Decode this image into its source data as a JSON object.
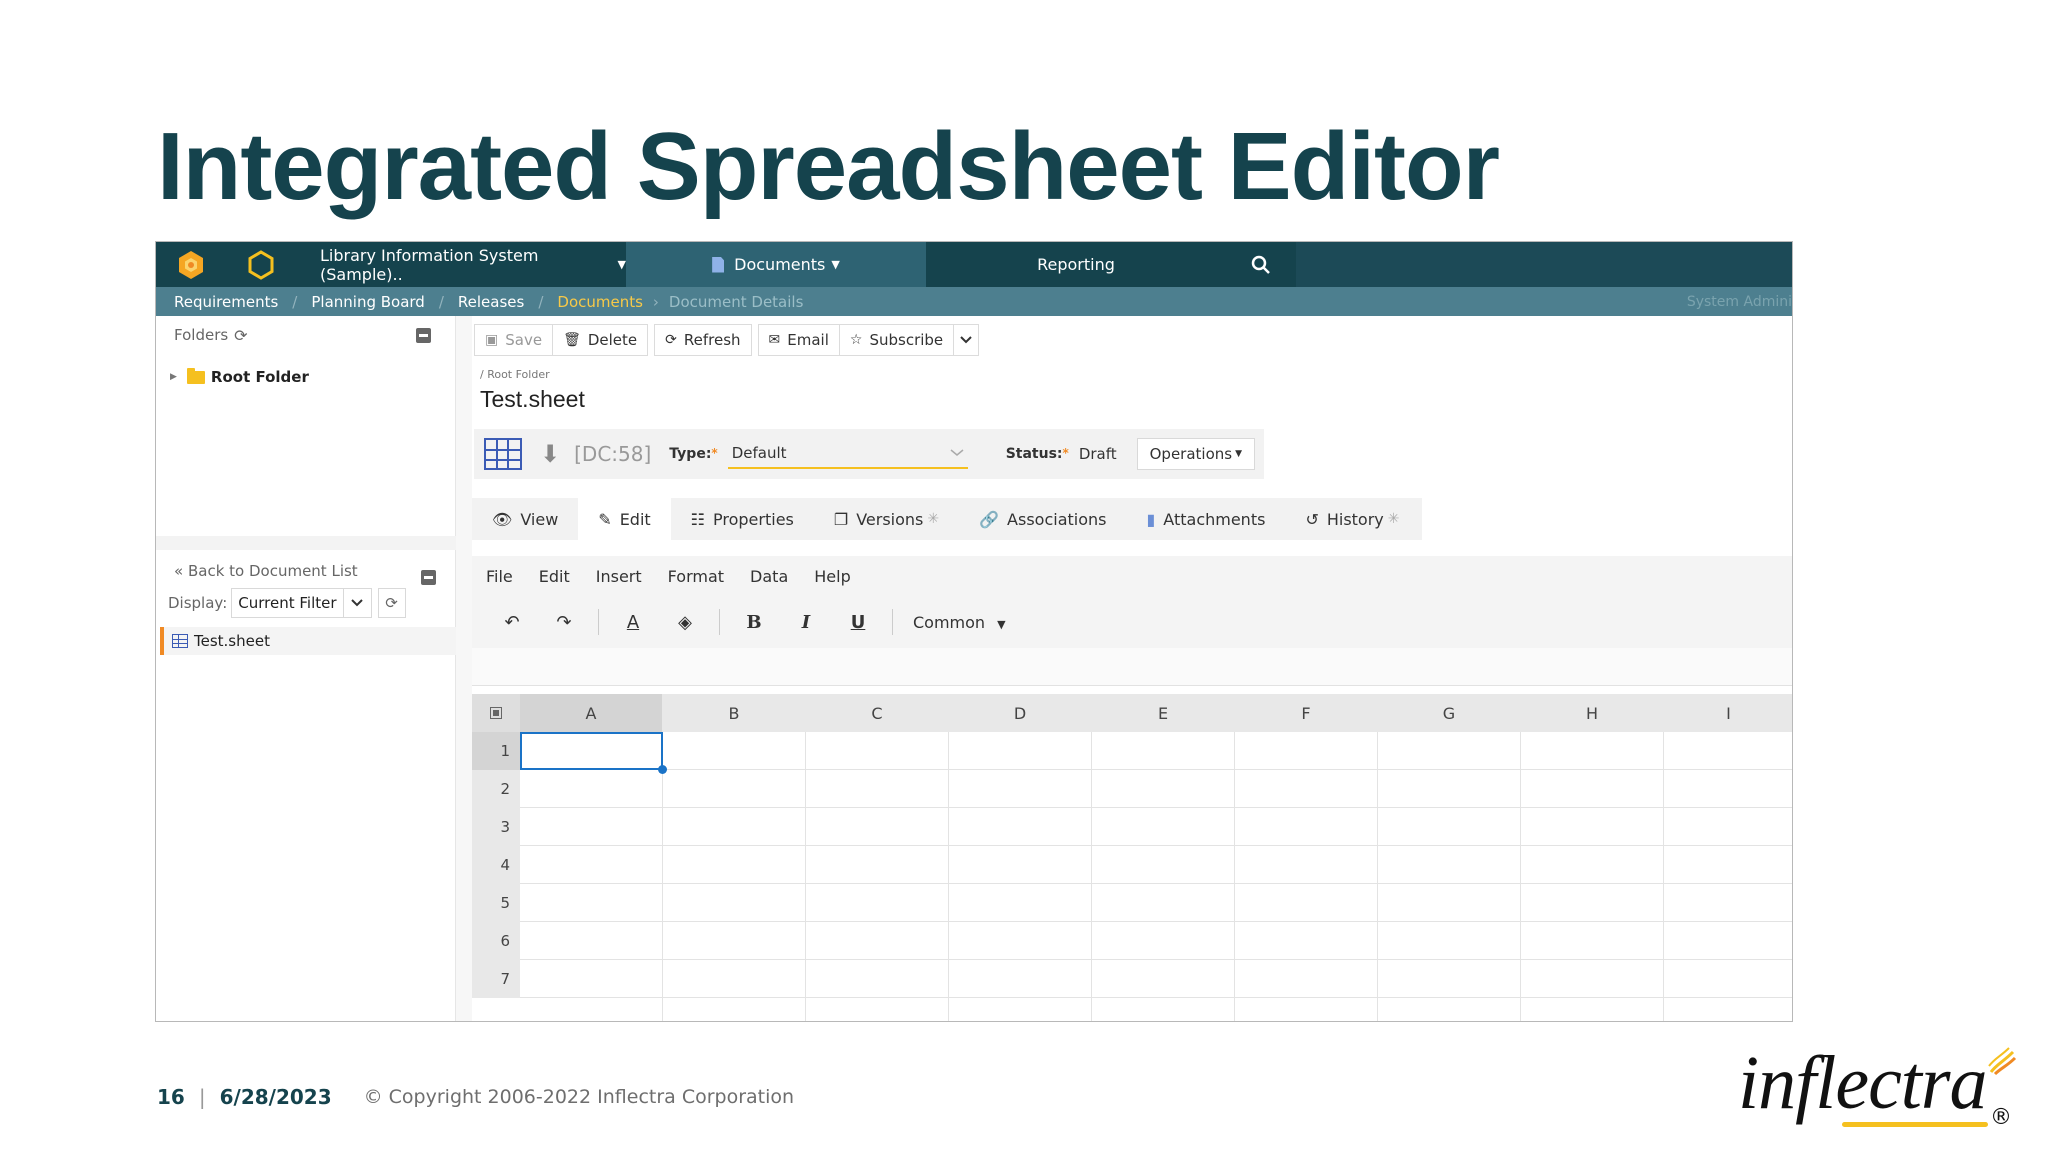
{
  "slide": {
    "title": "Integrated Spreadsheet Editor",
    "footer": {
      "page": "16",
      "separator": "|",
      "date": "6/28/2023",
      "copyright": "© Copyright 2006-2022 Inflectra Corporation"
    },
    "brand": "inflectra",
    "brand_reg": "®"
  },
  "app": {
    "colors": {
      "nav_dark": "#15434d",
      "nav_active": "#2e6373",
      "crumb": "#4d7f8f",
      "accent_yellow": "#f5c01f",
      "accent_orange": "#f08a24",
      "selection_blue": "#1a73c7"
    },
    "nav": {
      "project": "Library Information System (Sample)..",
      "documents_tab": "Documents",
      "reporting_tab": "Reporting",
      "icons": [
        "spira-logo-icon",
        "hexagon-icon",
        "search-icon"
      ]
    },
    "breadcrumbs": {
      "items": [
        "Requirements",
        "Planning Board",
        "Releases",
        "Documents",
        "Document Details"
      ],
      "user": "System Admini"
    },
    "left_panel": {
      "folders_label": "Folders",
      "root_folder": "Root Folder",
      "back_link": "Back to Document List",
      "display_label": "Display:",
      "filter_value": "Current Filter",
      "doc_item": "Test.sheet"
    },
    "toolbar": {
      "save": "Save",
      "delete": "Delete",
      "refresh": "Refresh",
      "email": "Email",
      "subscribe": "Subscribe"
    },
    "document": {
      "path": "/ Root Folder",
      "title": "Test.sheet",
      "id": "[DC:58]",
      "type_label": "Type:",
      "type_value": "Default",
      "status_label": "Status:",
      "status_value": "Draft",
      "operations": "Operations"
    },
    "tabs": [
      "View",
      "Edit",
      "Properties",
      "Versions",
      "Associations",
      "Attachments",
      "History"
    ],
    "active_tab": "Edit",
    "sheet": {
      "menu": [
        "File",
        "Edit",
        "Insert",
        "Format",
        "Data",
        "Help"
      ],
      "format": {
        "bold": "B",
        "italic": "I",
        "underline": "U",
        "text_color": "A",
        "font": "Common"
      },
      "columns": [
        "A",
        "B",
        "C",
        "D",
        "E",
        "F",
        "G",
        "H",
        "I"
      ],
      "rows": [
        "1",
        "2",
        "3",
        "4",
        "5",
        "6",
        "7"
      ],
      "active_cell": "A1"
    }
  }
}
